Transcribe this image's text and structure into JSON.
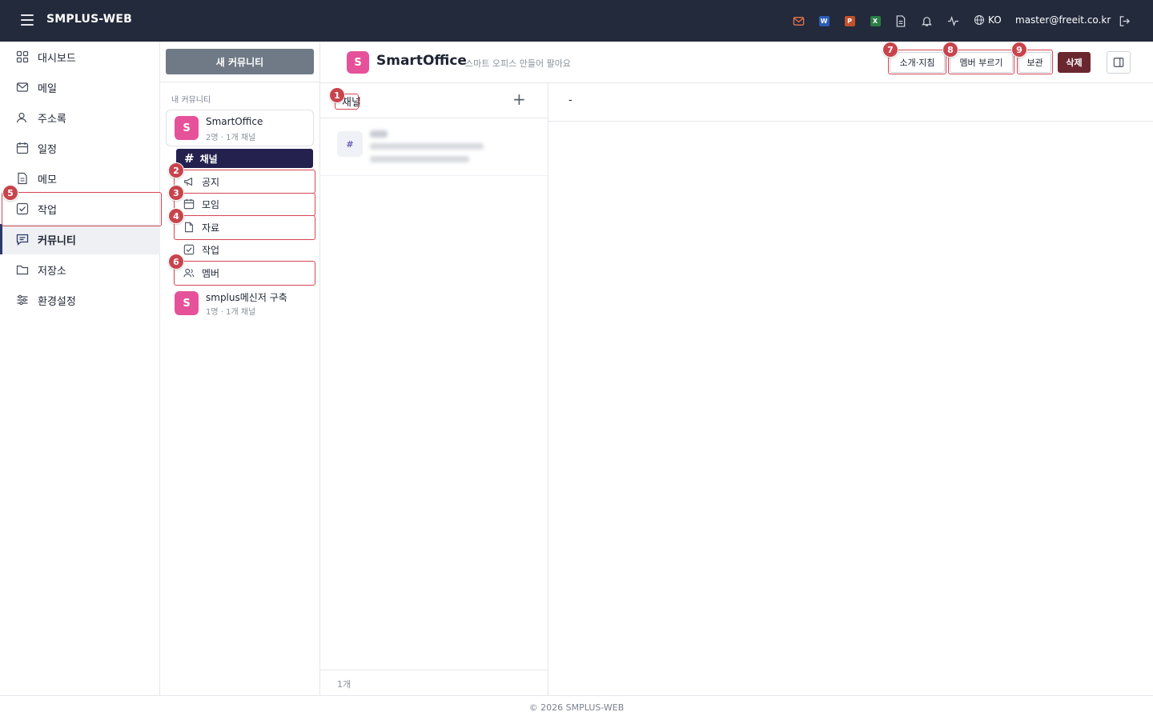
{
  "app": {
    "title": "SMPLUS-WEB",
    "lang": "KO",
    "user_email": "master@freeit.co.kr",
    "doc_badges": {
      "word": "W",
      "ppt": "P",
      "excel": "X"
    },
    "colors": {
      "topbar": "#222a3b",
      "accent": "#25214f",
      "danger": "#6b2730",
      "avatar": "#e5529a",
      "highlight": "#d64553"
    }
  },
  "leftnav": {
    "items": [
      {
        "label": "대시보드",
        "icon": "grid-icon"
      },
      {
        "label": "메일",
        "icon": "mail-icon"
      },
      {
        "label": "주소록",
        "icon": "contacts-icon"
      },
      {
        "label": "일정",
        "icon": "calendar-icon"
      },
      {
        "label": "메모",
        "icon": "memo-icon"
      },
      {
        "label": "작업",
        "icon": "task-check-icon"
      },
      {
        "label": "커뮤니티",
        "icon": "chat-icon",
        "active": true
      },
      {
        "label": "저장소",
        "icon": "folder-icon"
      },
      {
        "label": "환경설정",
        "icon": "sliders-icon"
      }
    ]
  },
  "community": {
    "new_button": "새 커뮤니티",
    "section_label": "내 커뮤니티",
    "list": [
      {
        "initial": "S",
        "name": "SmartOffice",
        "meta": "2명 · 1개 채널"
      },
      {
        "initial": "S",
        "name": "smplus메신저 구축",
        "meta": "1명 · 1개 채널"
      }
    ],
    "sub_menu": {
      "active": {
        "icon": "#",
        "label": "채널"
      },
      "items": [
        {
          "label": "공지",
          "icon": "megaphone-icon"
        },
        {
          "label": "모임",
          "icon": "calendar-icon"
        },
        {
          "label": "자료",
          "icon": "file-icon"
        },
        {
          "label": "작업",
          "icon": "task-check-icon"
        },
        {
          "label": "멤버",
          "icon": "members-icon"
        }
      ]
    }
  },
  "header": {
    "initial": "S",
    "title": "SmartOffice",
    "description": "스마트 오피스 만들어 팔아요",
    "buttons": {
      "intro": "소개·지침",
      "invite": "멤버 부르기",
      "archive": "보관",
      "delete": "삭제"
    }
  },
  "channels": {
    "title": "채널",
    "add": "+",
    "row_icon": "#",
    "count": "1개"
  },
  "detail": {
    "placeholder": "-"
  },
  "markers": [
    "1",
    "2",
    "3",
    "4",
    "5",
    "6",
    "7",
    "8",
    "9"
  ],
  "footer": {
    "text": "© 2026 SMPLUS-WEB"
  }
}
